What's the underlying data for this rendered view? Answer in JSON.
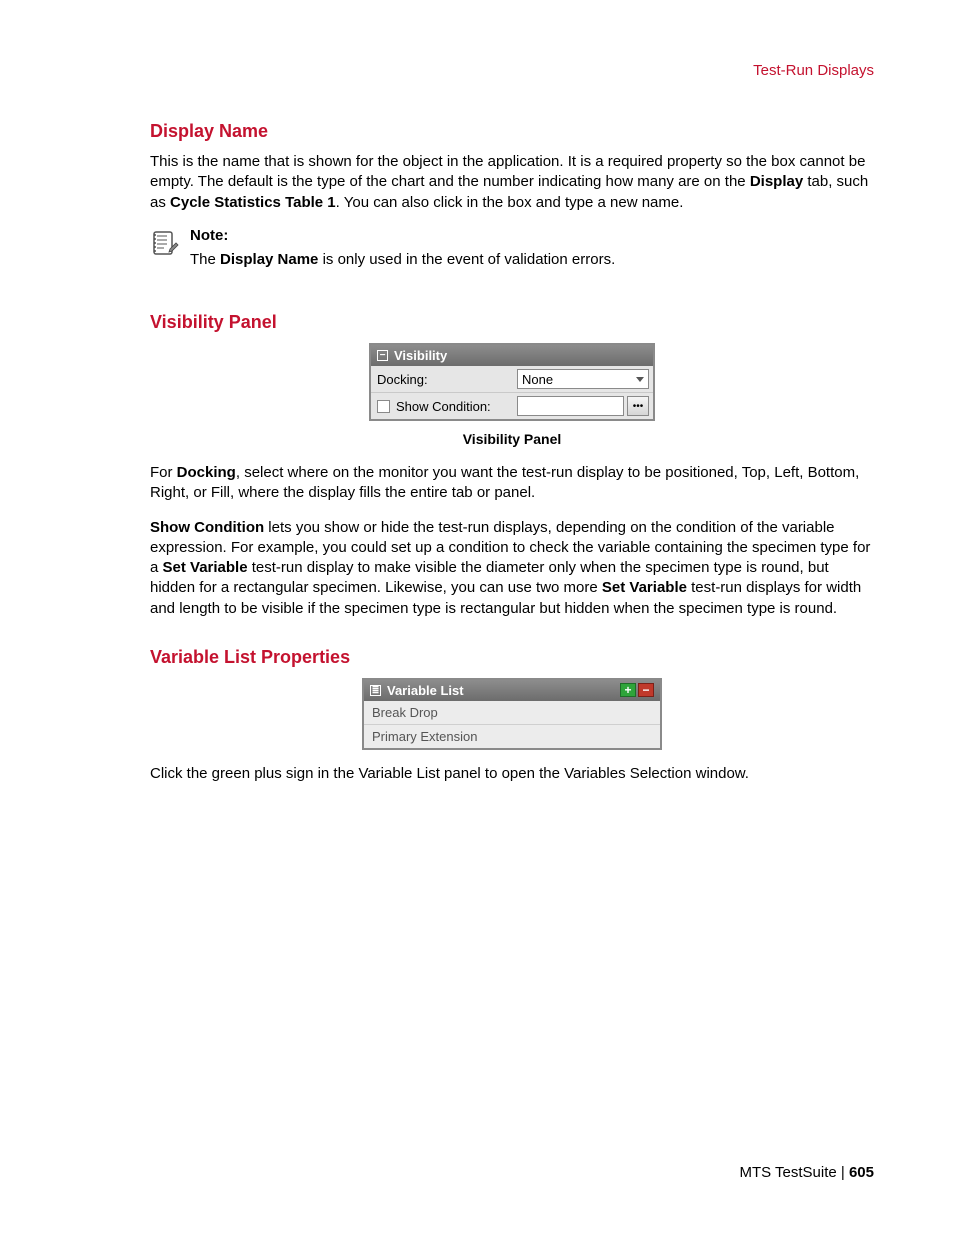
{
  "header": {
    "category": "Test-Run Displays"
  },
  "section_display_name": {
    "heading": "Display Name",
    "p1_a": "This is the name that is shown for the object in the application. It is a required property so the box cannot be empty. The default is the type of the chart and the number indicating how many are on the ",
    "p1_bold1": "Display",
    "p1_b": " tab, such as ",
    "p1_bold2": "Cycle Statistics Table 1",
    "p1_c": ". You can also click in the box and type a new name.",
    "note_label": "Note:",
    "note_a": "The ",
    "note_bold": "Display Name",
    "note_b": " is only used in the event of validation errors."
  },
  "section_visibility": {
    "heading": "Visibility Panel",
    "panel_title": "Visibility",
    "docking_label": "Docking:",
    "docking_value": "None",
    "show_condition_label": "Show Condition:",
    "caption": "Visibility Panel",
    "p1_a": "For ",
    "p1_bold1": "Docking",
    "p1_b": ", select where on the monitor you want the test-run display to be positioned, Top, Left, Bottom, Right, or Fill, where the display fills the entire tab or panel.",
    "p2_bold1": "Show Condition",
    "p2_a": " lets you show or hide the test-run displays, depending on the condition of the variable expression. For example, you could set up a condition to check the variable containing the specimen type for a ",
    "p2_bold2": "Set Variable",
    "p2_b": " test-run display to make visible the diameter only when the specimen type is round, but hidden for a rectangular specimen. Likewise, you can use two more ",
    "p2_bold3": "Set Variable",
    "p2_c": " test-run displays for width and length to be visible if the specimen type is rectangular but hidden when the specimen type is round."
  },
  "section_varlist": {
    "heading": "Variable List Properties",
    "panel_title": "Variable List",
    "items": [
      "Break Drop",
      "Primary Extension"
    ],
    "p1": "Click the green plus sign in the Variable List panel to open the Variables Selection window."
  },
  "footer": {
    "product": "MTS TestSuite",
    "sep": " | ",
    "page": "605"
  },
  "glyphs": {
    "minus": "−",
    "plus": "+",
    "dots": "•••",
    "list": "≣"
  }
}
